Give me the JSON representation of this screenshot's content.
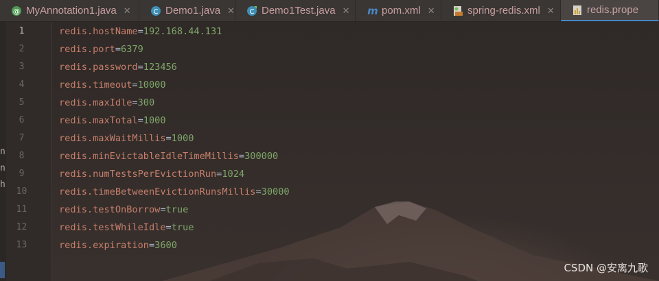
{
  "tabs": [
    {
      "label": "MyAnnotation1.java",
      "icon": "annotation-icon",
      "color": "#4e9a55"
    },
    {
      "label": "Demo1.java",
      "icon": "class-icon",
      "color": "#3f8fb5"
    },
    {
      "label": "Demo1Test.java",
      "icon": "test-class-icon",
      "color": "#3f8fb5"
    },
    {
      "label": "pom.xml",
      "icon": "maven-icon",
      "color": "#4a88c7"
    },
    {
      "label": "spring-redis.xml",
      "icon": "spring-xml-icon",
      "color": "#c47a2c"
    },
    {
      "label": "redis.prope",
      "icon": "properties-icon",
      "color": "#c9a03a",
      "active": true
    }
  ],
  "left_fragments": [
    "n",
    "n",
    "h"
  ],
  "code_lines": [
    {
      "num": "1",
      "key": "redis.hostName",
      "value": "192.168.44.131"
    },
    {
      "num": "2",
      "key": "redis.port",
      "value": "6379"
    },
    {
      "num": "3",
      "key": "redis.password",
      "value": "123456"
    },
    {
      "num": "4",
      "key": "redis.timeout",
      "value": "10000"
    },
    {
      "num": "5",
      "key": "redis.maxIdle",
      "value": "300"
    },
    {
      "num": "6",
      "key": "redis.maxTotal",
      "value": "1000"
    },
    {
      "num": "7",
      "key": "redis.maxWaitMillis",
      "value": "1000"
    },
    {
      "num": "8",
      "key": "redis.minEvictableIdleTimeMillis",
      "value": "300000"
    },
    {
      "num": "9",
      "key": "redis.numTestsPerEvictionRun",
      "value": "1024"
    },
    {
      "num": "10",
      "key": "redis.timeBetweenEvictionRunsMillis",
      "value": "30000"
    },
    {
      "num": "11",
      "key": "redis.testOnBorrow",
      "value": "true"
    },
    {
      "num": "12",
      "key": "redis.testWhileIdle",
      "value": "true"
    },
    {
      "num": "13",
      "key": "redis.expiration",
      "value": "3600"
    }
  ],
  "current_line": "1",
  "watermark": "CSDN @安离九歌"
}
